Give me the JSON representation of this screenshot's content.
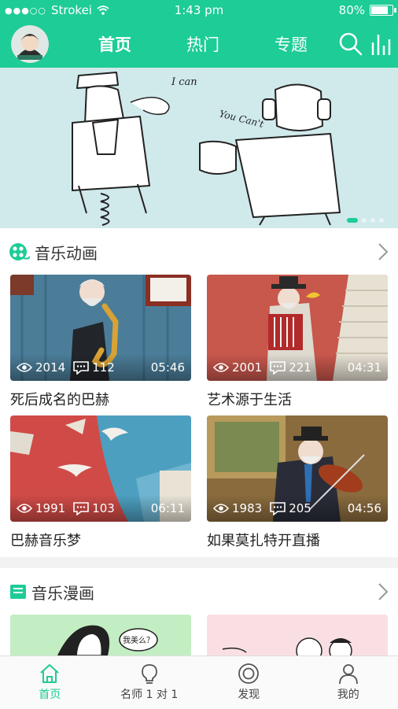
{
  "status_bar": {
    "carrier": "Strokei",
    "time": "1:43 pm",
    "battery": "80%",
    "battery_level": 0.8
  },
  "nav": {
    "tabs": [
      "首页",
      "热门",
      "专题"
    ]
  },
  "banner": {
    "caption_left": "I can",
    "caption_right": "You Can't",
    "pages": 4,
    "active_page": 0
  },
  "section1": {
    "title": "音乐动画",
    "cards": [
      {
        "views": "2014",
        "comments": "112",
        "duration": "05:46",
        "title": "死后成名的巴赫"
      },
      {
        "views": "2001",
        "comments": "221",
        "duration": "04:31",
        "title": "艺术源于生活"
      },
      {
        "views": "1991",
        "comments": "103",
        "duration": "06:11",
        "title": "巴赫音乐梦"
      },
      {
        "views": "1983",
        "comments": "205",
        "duration": "04:56",
        "title": "如果莫扎特开直播"
      }
    ]
  },
  "section2": {
    "title": "音乐漫画",
    "bubble_text": "我美么？"
  },
  "tab_bar": {
    "items": [
      "首页",
      "名师 1 对 1",
      "发现",
      "我的"
    ]
  },
  "colors": {
    "accent": "#1dcc96",
    "banner_bg": "#d0e9eb"
  }
}
